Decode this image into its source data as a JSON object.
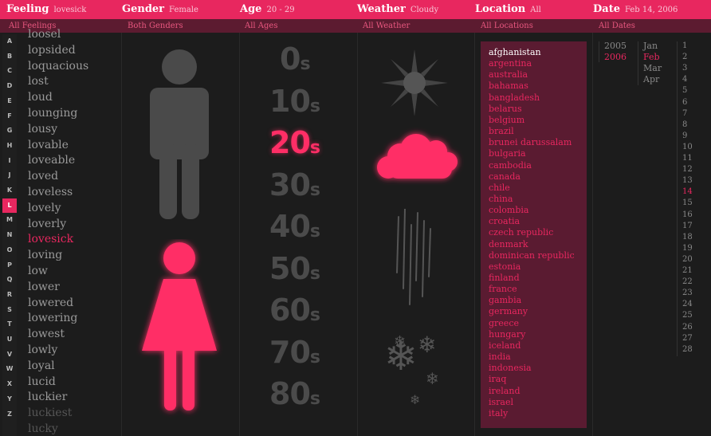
{
  "filters": {
    "feeling": {
      "label": "Feeling",
      "value": "lovesick",
      "all": "All Feelings"
    },
    "gender": {
      "label": "Gender",
      "value": "Female",
      "all": "Both Genders"
    },
    "age": {
      "label": "Age",
      "value": "20 - 29",
      "all": "All Ages"
    },
    "weather": {
      "label": "Weather",
      "value": "Cloudy",
      "all": "All Weather"
    },
    "location": {
      "label": "Location",
      "value": "All",
      "all": "All Locations"
    },
    "date": {
      "label": "Date",
      "value": "Feb 14, 2006",
      "all": "All Dates"
    }
  },
  "letters": [
    "A",
    "B",
    "C",
    "D",
    "E",
    "F",
    "G",
    "H",
    "I",
    "J",
    "K",
    "L",
    "M",
    "N",
    "O",
    "P",
    "Q",
    "R",
    "S",
    "T",
    "U",
    "V",
    "W",
    "X",
    "Y",
    "Z"
  ],
  "active_letter": "L",
  "feelings": [
    "loosel",
    "lopsided",
    "loquacious",
    "lost",
    "loud",
    "lounging",
    "lousy",
    "lovable",
    "loveable",
    "loved",
    "loveless",
    "lovely",
    "loverly",
    "lovesick",
    "loving",
    "low",
    "lower",
    "lowered",
    "lowering",
    "lowest",
    "lowly",
    "loyal",
    "lucid",
    "luckier",
    "luckiest",
    "lucky"
  ],
  "selected_feeling": "lovesick",
  "ages": [
    "0",
    "10",
    "20",
    "30",
    "40",
    "50",
    "60",
    "70",
    "80"
  ],
  "age_suffix": "s",
  "selected_age": "20",
  "weather_icons": [
    "sunny-icon",
    "cloudy-icon",
    "rain-icon",
    "snow-icon"
  ],
  "locations": [
    "afghanistan",
    "argentina",
    "australia",
    "bahamas",
    "bangladesh",
    "belarus",
    "belgium",
    "brazil",
    "brunei darussalam",
    "bulgaria",
    "cambodia",
    "canada",
    "chile",
    "china",
    "colombia",
    "croatia",
    "czech republic",
    "denmark",
    "dominican republic",
    "estonia",
    "finland",
    "france",
    "gambia",
    "germany",
    "greece",
    "hungary",
    "iceland",
    "india",
    "indonesia",
    "iraq",
    "ireland",
    "israel",
    "italy"
  ],
  "selected_location": "afghanistan",
  "years": [
    "2005",
    "2006"
  ],
  "selected_year": "2006",
  "months": [
    "Jan",
    "Feb",
    "Mar",
    "Apr"
  ],
  "selected_month": "Feb",
  "days": [
    "1",
    "2",
    "3",
    "4",
    "5",
    "6",
    "7",
    "8",
    "9",
    "10",
    "11",
    "12",
    "13",
    "14",
    "15",
    "16",
    "17",
    "18",
    "19",
    "20",
    "21",
    "22",
    "23",
    "24",
    "25",
    "26",
    "27",
    "28"
  ],
  "selected_day": "14",
  "colors": {
    "accent": "#e8275f",
    "background": "#1c1c1c",
    "list_bg": "#5a1b31",
    "inactive": "#4b4b4b"
  }
}
